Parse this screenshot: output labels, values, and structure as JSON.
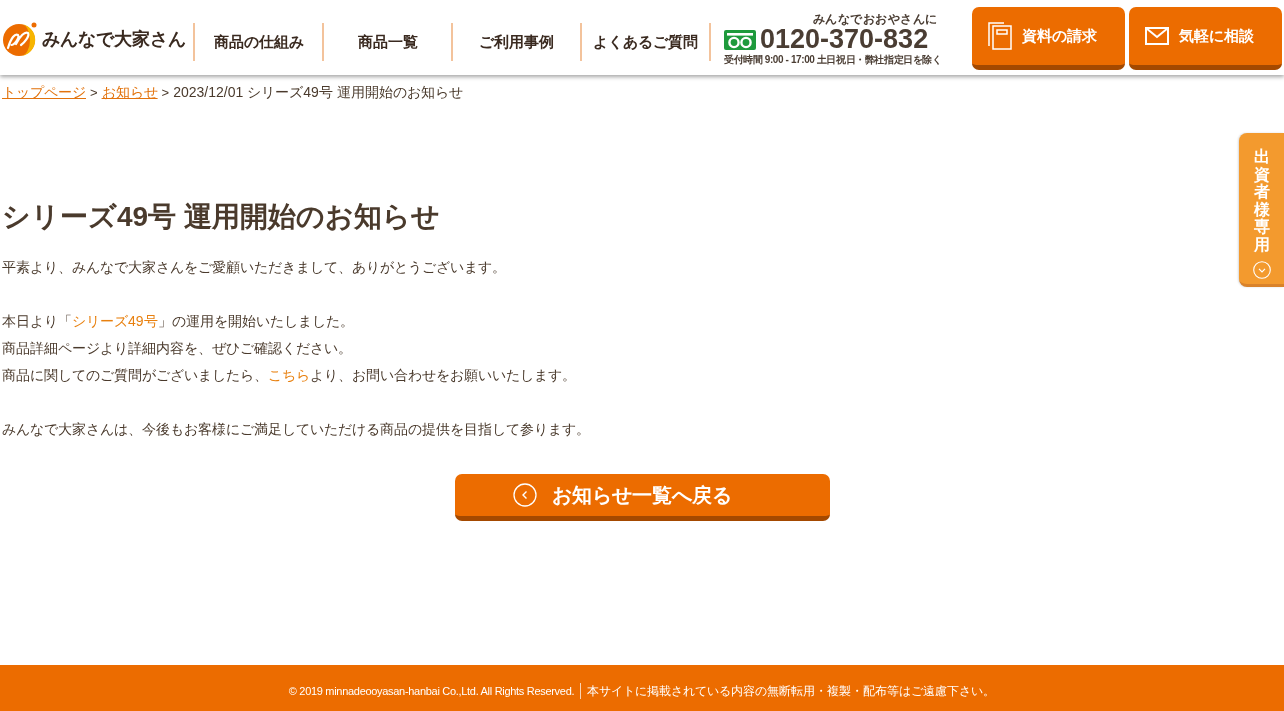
{
  "header": {
    "logo": {
      "text": "みんなで大家さん"
    },
    "nav": [
      {
        "label": "商品の仕組み"
      },
      {
        "label": "商品一覧"
      },
      {
        "label": "ご利用事例"
      },
      {
        "label": "よくあるご質問"
      }
    ],
    "phone": {
      "caption": "みんなでおおやさんに",
      "number": "0120-370-832",
      "hours": "受付時間 9:00 - 17:00 土日祝日・弊社指定日を除く"
    },
    "buttons": [
      {
        "kind": "documents",
        "label": "資料の請求"
      },
      {
        "kind": "mail",
        "label": "気軽に相談"
      }
    ]
  },
  "side_tab": {
    "label": "出資者様専用"
  },
  "breadcrumb": [
    {
      "kind": "link",
      "label": "トップページ"
    },
    {
      "kind": "separator",
      "label": ">"
    },
    {
      "kind": "link",
      "label": "お知らせ"
    },
    {
      "kind": "separator",
      "label": ">"
    },
    {
      "kind": "current",
      "label": "2023/12/01 シリーズ49号 運用開始のお知らせ"
    }
  ],
  "article": {
    "title": "シリーズ49号 運用開始のお知らせ",
    "paragraphs": [
      {
        "lines": [
          {
            "segments": [
              {
                "kind": "text",
                "text": "平素より、みんなで大家さんをご愛顧いただきまして、ありがとうございます。"
              }
            ]
          }
        ]
      },
      {
        "lines": [
          {
            "segments": [
              {
                "kind": "text",
                "text": "本日より「"
              },
              {
                "kind": "link",
                "text": "シリーズ49号"
              },
              {
                "kind": "text",
                "text": "」の運用を開始いたしました。"
              }
            ]
          },
          {
            "segments": [
              {
                "kind": "text",
                "text": "商品詳細ページより詳細内容を、ぜひご確認ください。"
              }
            ]
          },
          {
            "segments": [
              {
                "kind": "text",
                "text": "商品に関してのご質問がございましたら、"
              },
              {
                "kind": "link",
                "text": "こちら"
              },
              {
                "kind": "text",
                "text": "より、お問い合わせをお願いいたします。"
              }
            ]
          }
        ]
      },
      {
        "lines": [
          {
            "segments": [
              {
                "kind": "text",
                "text": "みんなで大家さんは、今後もお客様にご満足していただける商品の提供を目指して参ります。"
              }
            ]
          }
        ]
      }
    ],
    "back_button": {
      "label": "お知らせ一覧へ戻る"
    }
  },
  "footer": {
    "copyright": "© 2019 minnadeooyasan-hanbai Co.,Ltd. All Rights Reserved.",
    "notice": "本サイトに掲載されている内容の無断転用・複製・配布等はご遠慮下さい。"
  }
}
